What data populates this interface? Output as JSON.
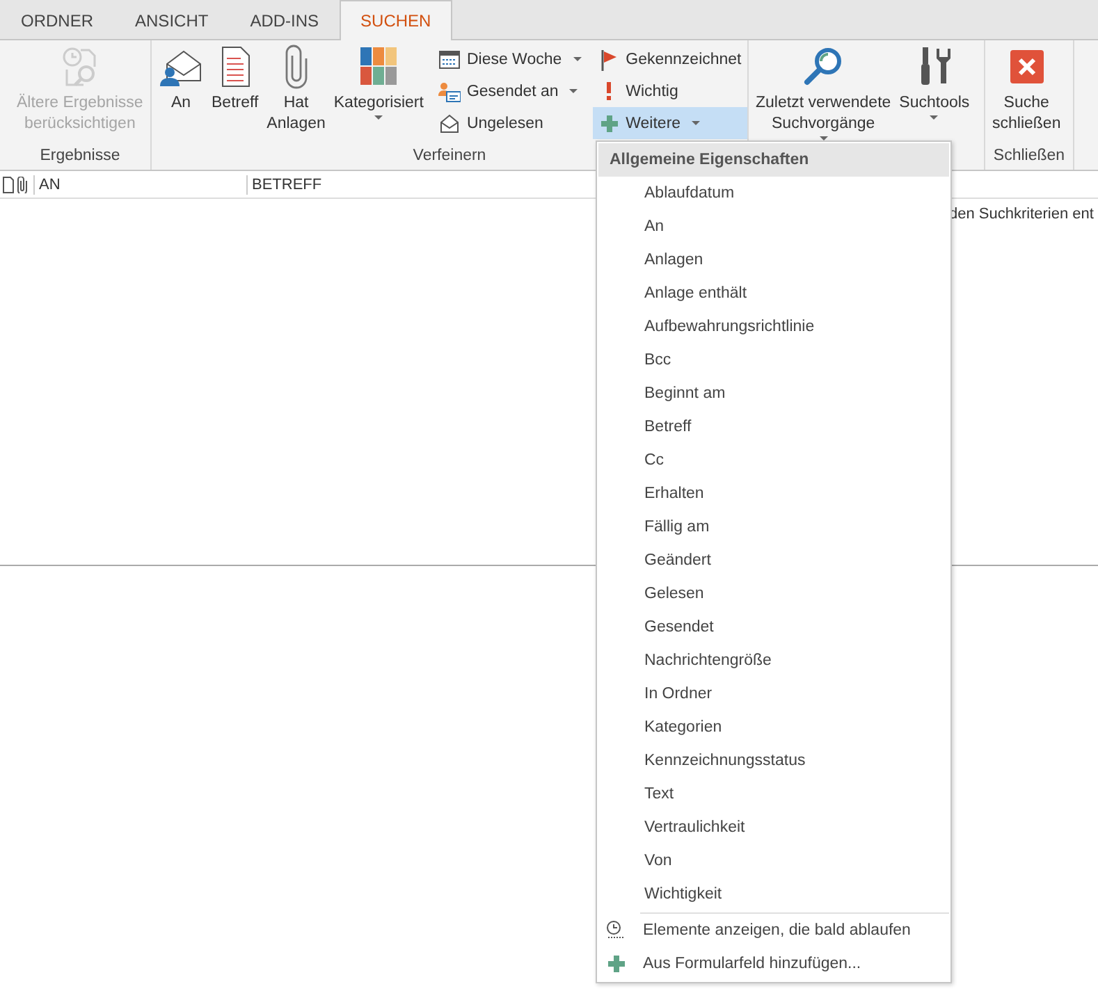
{
  "tabs": [
    {
      "label": "ORDNER",
      "selected": false
    },
    {
      "label": "ANSICHT",
      "selected": false
    },
    {
      "label": "ADD-INS",
      "selected": false
    },
    {
      "label": "SUCHEN",
      "selected": true
    }
  ],
  "ribbon": {
    "results": {
      "label": "Ergebnisse",
      "button": {
        "label": "Ältere Ergebnisse\nberücksichtigen",
        "disabled": true
      }
    },
    "refine": {
      "label": "Verfeinern",
      "large_buttons": [
        {
          "label": "An",
          "dropdown": false
        },
        {
          "label": "Betreff",
          "dropdown": false
        },
        {
          "label": "Hat\nAnlagen",
          "dropdown": false
        },
        {
          "label": "Kategorisiert",
          "dropdown": true
        }
      ],
      "small_buttons": [
        {
          "label": "Diese Woche",
          "dropdown": true,
          "expanded": false
        },
        {
          "label": "Gesendet an",
          "dropdown": true,
          "expanded": false
        },
        {
          "label": "Ungelesen",
          "dropdown": false,
          "expanded": false
        },
        {
          "label": "Gekennzeichnet",
          "dropdown": false,
          "expanded": false
        },
        {
          "label": "Wichtig",
          "dropdown": false,
          "expanded": false
        },
        {
          "label": "Weitere",
          "dropdown": true,
          "expanded": true
        }
      ]
    },
    "options": {
      "large_buttons": [
        {
          "label": "Zuletzt verwendete\nSuchvorgänge",
          "dropdown": true
        },
        {
          "label": "Suchtools",
          "dropdown": true
        }
      ]
    },
    "close": {
      "label": "Schließen",
      "button": {
        "label": "Suche\nschließen"
      }
    }
  },
  "list": {
    "columns": [
      "AN",
      "BETREFF"
    ],
    "message": "den Suchkriterien ent"
  },
  "menu": {
    "header": "Allgemeine Eigenschaften",
    "items": [
      "Ablaufdatum",
      "An",
      "Anlagen",
      "Anlage enthält",
      "Aufbewahrungsrichtlinie",
      "Bcc",
      "Beginnt am",
      "Betreff",
      "Cc",
      "Erhalten",
      "Fällig am",
      "Geändert",
      "Gelesen",
      "Gesendet",
      "Nachrichtengröße",
      "In Ordner",
      "Kategorien",
      "Kennzeichnungsstatus",
      "Text",
      "Vertraulichkeit",
      "Von",
      "Wichtigkeit"
    ],
    "actions": [
      "Elemente anzeigen, die bald ablaufen",
      "Aus Formularfeld hinzufügen..."
    ]
  }
}
